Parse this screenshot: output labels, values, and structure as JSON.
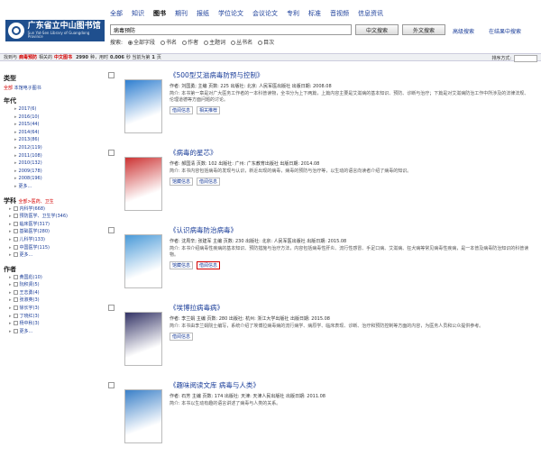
{
  "header": {
    "logo_title": "广东省立中山图书馆",
    "logo_subtitle": "Sun Yat-Sen Library of Guangdong Province",
    "categories": [
      "全部",
      "知识",
      "图书",
      "期刊",
      "报纸",
      "学位论文",
      "会议论文",
      "专利",
      "标准",
      "音视频",
      "信息资讯"
    ],
    "active_category": 2,
    "search_value": "病毒预防",
    "btn_search": "中文搜索",
    "btn_search_rel": "外文搜索",
    "adv_link": "高级搜索",
    "back_link": "在结果中搜索",
    "radio_label": "搜索:",
    "radios": [
      "全部字段",
      "书名",
      "作者",
      "主题词",
      "丛书名",
      "目次"
    ],
    "radio_selected": 0
  },
  "stats": {
    "prefix": "找到与",
    "keyword": "病毒预防",
    "middle": "相关的",
    "type": "中文图书",
    "count": "2990",
    "suffix": "种，用时",
    "time": "0.006",
    "unit": "秒 当前为第",
    "page": "1",
    "page_unit": "页",
    "sort_label": "排序方式:"
  },
  "sidebar": {
    "type_title": "类型",
    "type_all": "全部",
    "type_all_suffix": "本馆电子图书",
    "year_title": "年代",
    "years": [
      "2017(6)",
      "2016(10)",
      "2015(44)",
      "2014(64)",
      "2013(86)",
      "2012(119)",
      "2011(108)",
      "2010(132)",
      "2009(178)",
      "2008(196)",
      "更多..."
    ],
    "subject_title": "学科",
    "subject_path": "全部>医药、卫生",
    "subjects": [
      "内科学(668)",
      "预防医学、卫生学(346)",
      "临床医学(317)",
      "基础医学(280)",
      "儿科学(133)",
      "中国医学(115)",
      "更多..."
    ],
    "author_title": "作者",
    "authors": [
      "黄国彪(10)",
      "阮积贤(5)",
      "王志勇(4)",
      "张淑英(3)",
      "徐长宇(3)",
      "丁晓红(3)",
      "杨中秋(3)",
      "更多..."
    ]
  },
  "results": [
    {
      "title": "《500型艾滋病毒防预与控制》",
      "meta": "作者: 刘国勇; 主编 页数: 225 出版社: 北京: 人民军医出版社 出版日期: 2008.08",
      "abstract": "简介: 本书第一章是对广大医务工作者的一本科普读物，全书分为上下两篇，上篇内容主要是艾滋病的基本知识、预防、诊断与治疗；下篇是对艾滋病防治工作中所涉及的法律法规、伦理道德等方面问题的讨论。",
      "actions": [
        "借阅信息",
        "相关推荐"
      ]
    },
    {
      "title": "《病毒的星芯》",
      "meta": "作者: 郝国清 页数: 102 出版社: 广州: 广东教育出版社 出版日期: 2014.08",
      "abstract": "简介: 本书内容包括病毒的发现与认识，新近出现的病毒，病毒的预防与治疗等，以生动的语言向读者介绍了病毒的知识。",
      "actions": [
        "馆藏信息",
        "借阅信息"
      ]
    },
    {
      "title": "《认识病毒防治病毒》",
      "meta": "作者: 沈周辛; 张建军 主编 页数: 230 出版社: 北京: 人民军医出版社 出版日期: 2015.08",
      "abstract": "简介: 本书介绍病毒性疾病的基本知识、预防措施与治疗方法，内容包括病毒性肝炎、流行性感冒、手足口病、艾滋病、狂犬病等常见病毒性疾病，是一本普及病毒防治知识的科普读物。",
      "actions": [
        "馆藏信息",
        "借阅信息"
      ]
    },
    {
      "title": "《埃博拉病毒病》",
      "meta": "作者: 李兰娟 主编 页数: 280 出版社: 杭州: 浙江大学出版社 出版日期: 2015.08",
      "abstract": "简介: 本书由李兰娟院士编写，系统介绍了埃博拉病毒病的流行病学、病原学、临床表现、诊断、治疗和预防控制等方面的内容，为医务人员和公众提供参考。",
      "actions": [
        "借阅信息"
      ]
    },
    {
      "title": "《趣味阅读文库 病毒与人类》",
      "meta": "作者: 石芳 主编 页数: 174 出版社: 天津: 天津人民出版社 出版日期: 2011.08",
      "abstract": "简介: 本书以生动有趣的语言讲述了病毒与人类的关系。",
      "actions": []
    }
  ]
}
